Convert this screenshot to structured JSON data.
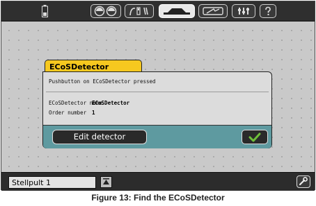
{
  "toolbar": {
    "icons": [
      "battery-icon",
      "speedometer-icon",
      "functions-icon",
      "track-icon",
      "locomotive-icon",
      "switchboard-icon",
      "help-icon"
    ]
  },
  "dialog": {
    "title": "ECoSDetector",
    "message": "Pushbutton on ECoSDetector pressed",
    "name_label": "ECoSDetector name",
    "name_value": "ECoSDetector",
    "order_label": "Order number",
    "order_value": "1",
    "edit_button": "Edit detector"
  },
  "bottom": {
    "panel_name": "Stellpult 1"
  },
  "caption": "Figure 13: Find the ECoSDetector",
  "colors": {
    "dialog_tab": "#f6c81f",
    "dialog_footer": "#5e9aa0",
    "ok_check": "#6fc03a"
  }
}
